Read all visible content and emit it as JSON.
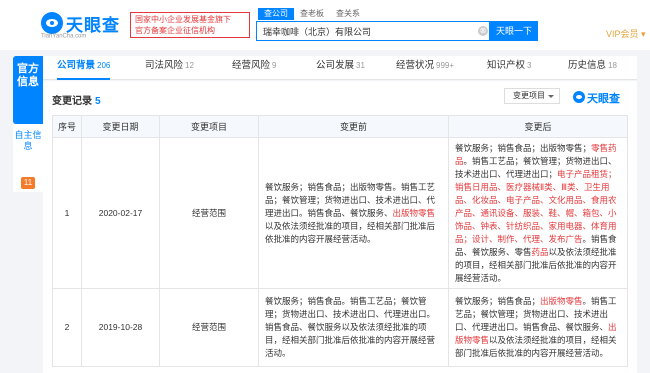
{
  "header": {
    "logo_text": "天眼查",
    "logo_sub": "TianYanCha.com",
    "badge_line1": "国家中小企业发展基金旗下",
    "badge_line2": "官方备案企业征信机构",
    "search_tabs": [
      "查公司",
      "查老板",
      "查关系"
    ],
    "search_value": "瑞幸咖啡（北京）有限公司",
    "clear_icon": "⊗",
    "search_button": "天眼一下",
    "vip_label": "VIP会员 ▾"
  },
  "sidebar": {
    "official_label": "官方信息",
    "self_label": "自主信息",
    "self_count": "11"
  },
  "categories": [
    {
      "label": "公司背景",
      "count": "206"
    },
    {
      "label": "司法风险",
      "count": "12"
    },
    {
      "label": "经营风险",
      "count": "9"
    },
    {
      "label": "公司发展",
      "count": "31"
    },
    {
      "label": "经营状况",
      "count": "999+"
    },
    {
      "label": "知识产权",
      "count": "3"
    },
    {
      "label": "历史信息",
      "count": "18"
    }
  ],
  "section": {
    "title": "变更记录",
    "count": "5",
    "filter_label": "变更项目",
    "watermark": "天眼查"
  },
  "table": {
    "headers": [
      "序号",
      "变更日期",
      "变更项目",
      "变更前",
      "变更后"
    ],
    "rows": [
      {
        "index": "1",
        "date": "2020-02-17",
        "item": "经营范围",
        "before": [
          {
            "t": "餐饮服务；销售食品；出版物零售。销售工艺品；餐饮管理；货物进出口、技术进出口、代理进出口。销售食品、餐饮服务、",
            "h": false
          },
          {
            "t": "出版物零售",
            "h": true
          },
          {
            "t": "以及依法须经批准的项目，经相关部门批准后依批准的内容开展经营活动。",
            "h": false
          }
        ],
        "after": [
          {
            "t": "餐饮服务；销售食品；出版物零售；",
            "h": false
          },
          {
            "t": "零售药品",
            "h": true
          },
          {
            "t": "。销售工艺品；餐饮管理；货物进出口、技术进出口、代理进出口；",
            "h": false
          },
          {
            "t": "电子产品租赁；销售日用品、医疗器械Ⅱ类、Ⅲ类、卫生用品、化妆品、电子产品、文化用品、食用农产品、通讯设备、服装、鞋、帽、箱包、小饰品、钟表、针纺织品、家用电器、体育用品；设计、制作、代理、发布广告",
            "h": true
          },
          {
            "t": "。销售食品、餐饮服务、零售",
            "h": false
          },
          {
            "t": "药品",
            "h": true
          },
          {
            "t": "以及依法须经批准的项目，经相关部门批准后依批准的内容开展经营活动。",
            "h": false
          }
        ]
      },
      {
        "index": "2",
        "date": "2019-10-28",
        "item": "经营范围",
        "before": [
          {
            "t": "餐饮服务；销售食品。销售工艺品；餐饮管理；货物进出口、技术进出口、代理进出口。销售食品、餐饮服务以及依法须经批准的项目，经相关部门批准后依批准的内容开展经营活动。",
            "h": false
          }
        ],
        "after": [
          {
            "t": "餐饮服务；销售食品；",
            "h": false
          },
          {
            "t": "出版物零售",
            "h": true
          },
          {
            "t": "。销售工艺品；餐饮管理；货物进出口、技术进出口、代理进出口。销售食品、餐饮服务、",
            "h": false
          },
          {
            "t": "出版物零售",
            "h": true
          },
          {
            "t": "以及依法须经批准的项目，经相关部门批准后依批准的内容开展经营活动。",
            "h": false
          }
        ]
      }
    ]
  },
  "colors": {
    "brand": "#0084ff",
    "highlight": "#e4393c",
    "vip": "#e5a33d",
    "badge_orange": "#f57b2a"
  }
}
